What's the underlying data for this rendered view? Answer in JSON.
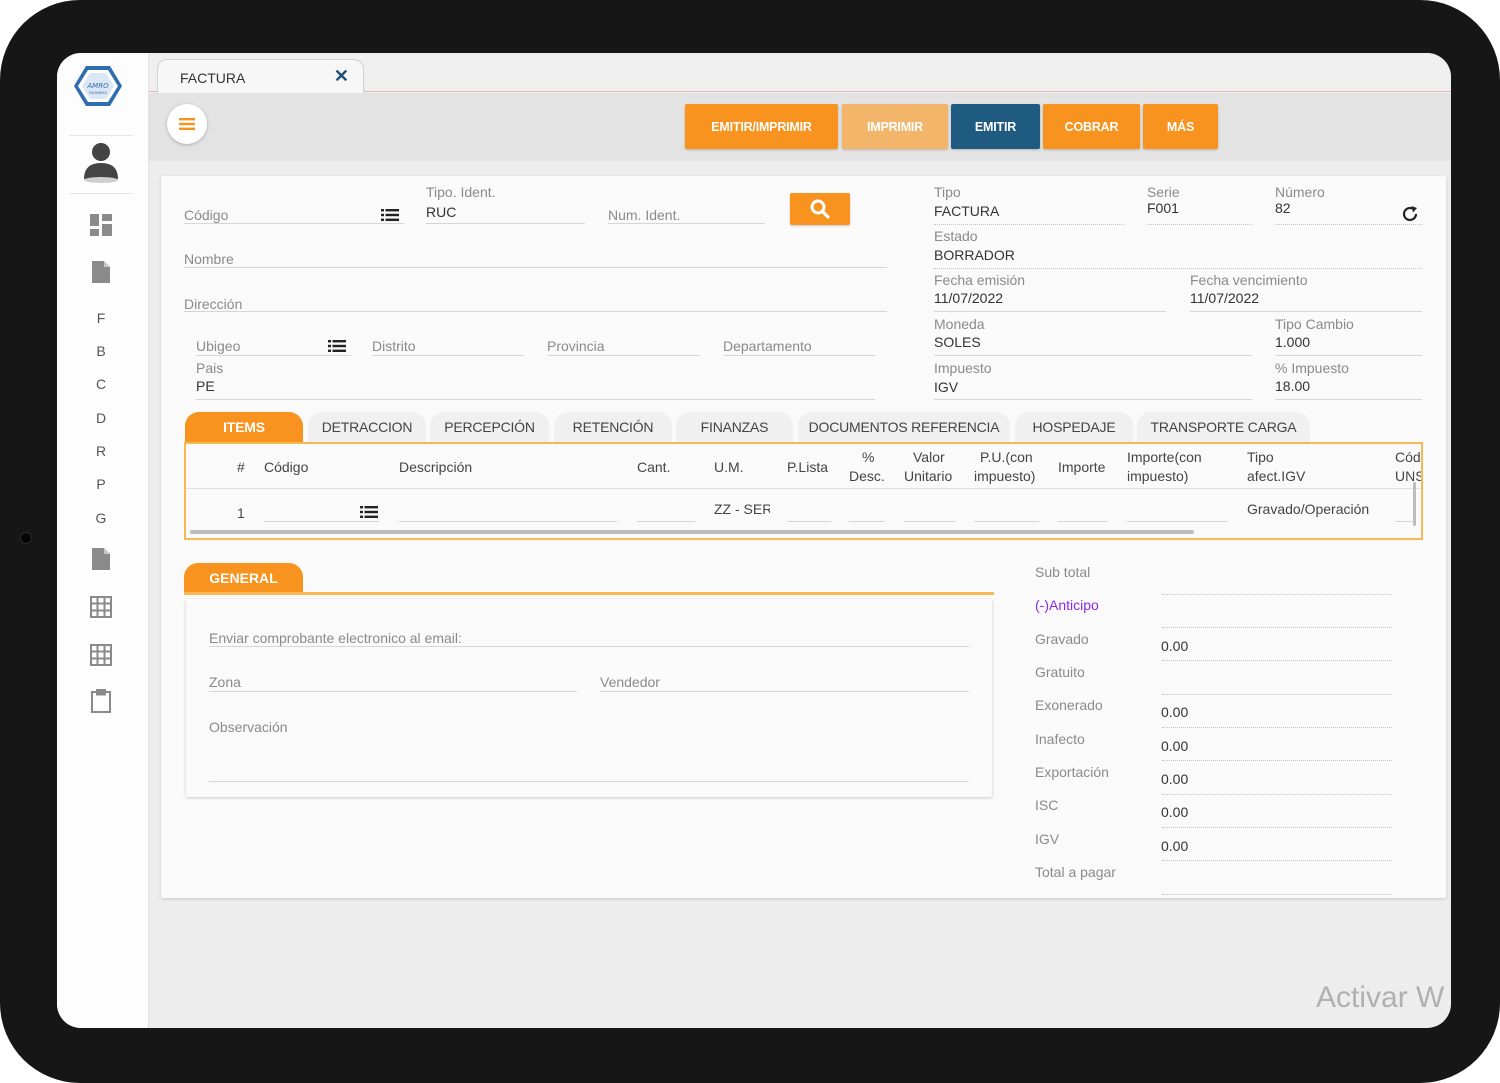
{
  "tab": {
    "title": "FACTURA",
    "close": "✕"
  },
  "sidebar": {
    "letters": [
      "F",
      "B",
      "C",
      "D",
      "R",
      "P",
      "G"
    ]
  },
  "toolbar": {
    "emitir_imprimir": "EMITIR/IMPRIMIR",
    "imprimir": "IMPRIMIR",
    "emitir": "EMITIR",
    "cobrar": "COBRAR",
    "mas": "MÁS"
  },
  "cliente": {
    "codigo_label": "Código",
    "tipo_ident_label": "Tipo. Ident.",
    "tipo_ident_value": "RUC",
    "num_ident_label": "Num. Ident.",
    "nombre_label": "Nombre",
    "direccion_label": "Dirección",
    "ubigeo_label": "Ubigeo",
    "distrito_label": "Distrito",
    "provincia_label": "Provincia",
    "departamento_label": "Departamento",
    "pais_label": "Pais",
    "pais_value": "PE"
  },
  "documento": {
    "tipo_label": "Tipo",
    "tipo_value": "FACTURA",
    "serie_label": "Serie",
    "serie_value": "F001",
    "numero_label": "Número",
    "numero_value": "82",
    "estado_label": "Estado",
    "estado_value": "BORRADOR",
    "fecha_emision_label": "Fecha emisión",
    "fecha_emision_value": "11/07/2022",
    "fecha_venc_label": "Fecha vencimiento",
    "fecha_venc_value": "11/07/2022",
    "moneda_label": "Moneda",
    "moneda_value": "SOLES",
    "tipo_cambio_label": "Tipo Cambio",
    "tipo_cambio_value": "1.000",
    "impuesto_label": "Impuesto",
    "impuesto_value": "IGV",
    "pct_impuesto_label": "% Impuesto",
    "pct_impuesto_value": "18.00"
  },
  "tabs": [
    "ITEMS",
    "DETRACCION",
    "PERCEPCIÓN",
    "RETENCIÓN",
    "FINANZAS",
    "DOCUMENTOS REFERENCIA",
    "HOSPEDAJE",
    "TRANSPORTE CARGA"
  ],
  "items": {
    "headers": {
      "num": "#",
      "codigo": "Código",
      "descripcion": "Descripción",
      "cant": "Cant.",
      "um": "U.M.",
      "plista": "P.Lista",
      "desc1": "%",
      "desc2": "Desc.",
      "valor1": "Valor",
      "valor2": "Unitario",
      "pu1": "P.U.(con",
      "pu2": "impuesto)",
      "importe": "Importe",
      "imp1": "Importe(con",
      "imp2": "impuesto)",
      "tipo1": "Tipo",
      "tipo2": "afect.IGV",
      "cod1": "Cód",
      "cod2": "UNS"
    },
    "row": {
      "num": "1",
      "um": "ZZ - SER",
      "tipo_afect": "Gravado/Operación"
    }
  },
  "general": {
    "tab": "GENERAL",
    "email_label": "Enviar comprobante electronico al email:",
    "zona_label": "Zona",
    "vendedor_label": "Vendedor",
    "observacion_label": "Observación"
  },
  "totales": {
    "subtotal_label": "Sub total",
    "anticipo_label": "(-)Anticipo",
    "gravado_label": "Gravado",
    "gravado_value": "0.00",
    "gratuito_label": "Gratuito",
    "exonerado_label": "Exonerado",
    "exonerado_value": "0.00",
    "inafecto_label": "Inafecto",
    "inafecto_value": "0.00",
    "exportacion_label": "Exportación",
    "exportacion_value": "0.00",
    "isc_label": "ISC",
    "isc_value": "0.00",
    "igv_label": "IGV",
    "igv_value": "0.00",
    "total_label": "Total a pagar"
  },
  "watermark": "Activar W",
  "colors": {
    "orange": "#f7931e",
    "orange_light": "#f2b56a",
    "navy": "#1f5a80",
    "anticipo": "#8a2be2"
  }
}
